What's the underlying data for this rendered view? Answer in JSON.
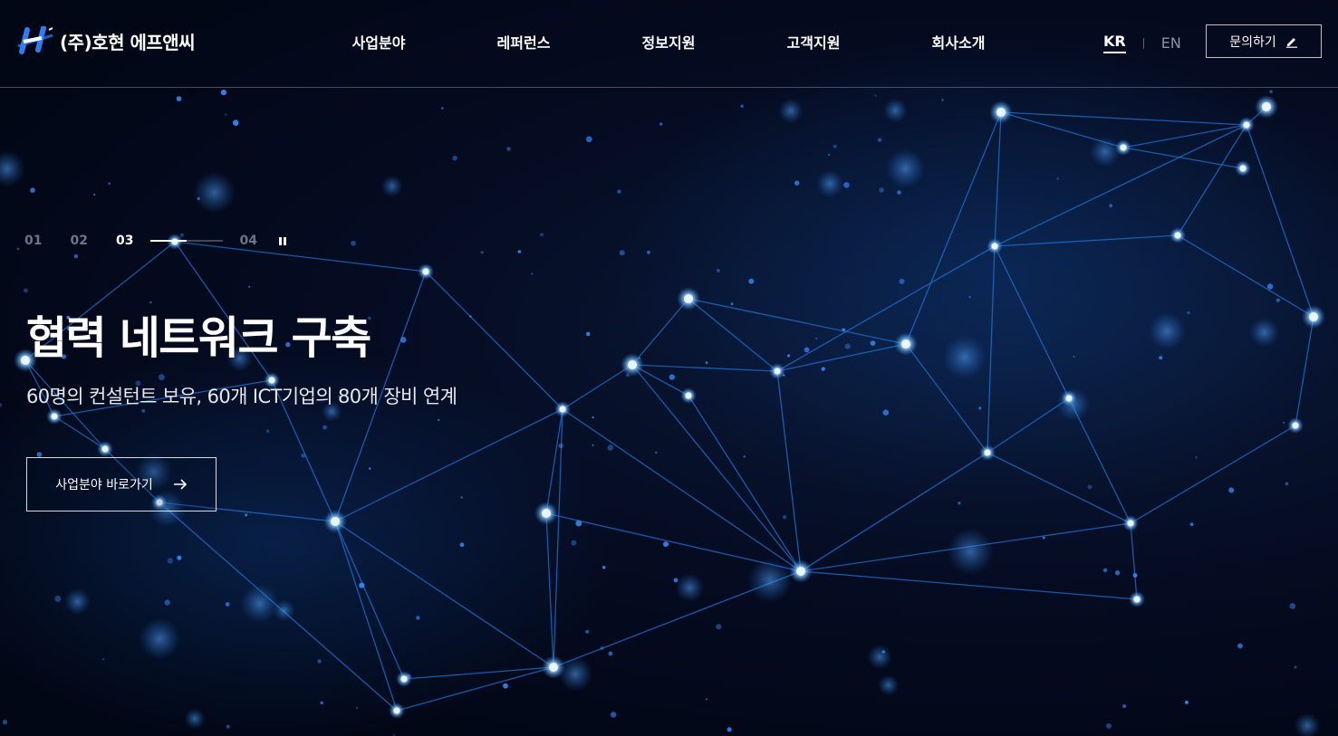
{
  "header": {
    "logo_text": "(주)호현 에프앤씨",
    "logo_icon": "hohyun-logo-icon",
    "nav": [
      {
        "label": "사업분야"
      },
      {
        "label": "레퍼런스"
      },
      {
        "label": "정보지원"
      },
      {
        "label": "고객지원"
      },
      {
        "label": "회사소개"
      }
    ],
    "lang": {
      "kr": "KR",
      "en": "EN",
      "active": "KR"
    },
    "inquiry_label": "문의하기",
    "inquiry_icon": "pencil-icon"
  },
  "slider": {
    "pages": [
      "01",
      "02",
      "03",
      "04"
    ],
    "active_index": 2,
    "progress": 0.5,
    "pause_icon": "pause-icon"
  },
  "hero": {
    "title": "협력 네트워크 구축",
    "subtitle": "60명의 컨설턴트 보유, 60개 ICT기업의 80개 장비 연계",
    "cta_label": "사업분야 바로가기",
    "cta_icon": "arrow-right-icon"
  },
  "colors": {
    "background": "#020716",
    "network_line": "#1f74d6",
    "network_node": "#bfe3ff",
    "logo_blue": "#1a5fd0",
    "inactive_text": "#6b7488"
  }
}
